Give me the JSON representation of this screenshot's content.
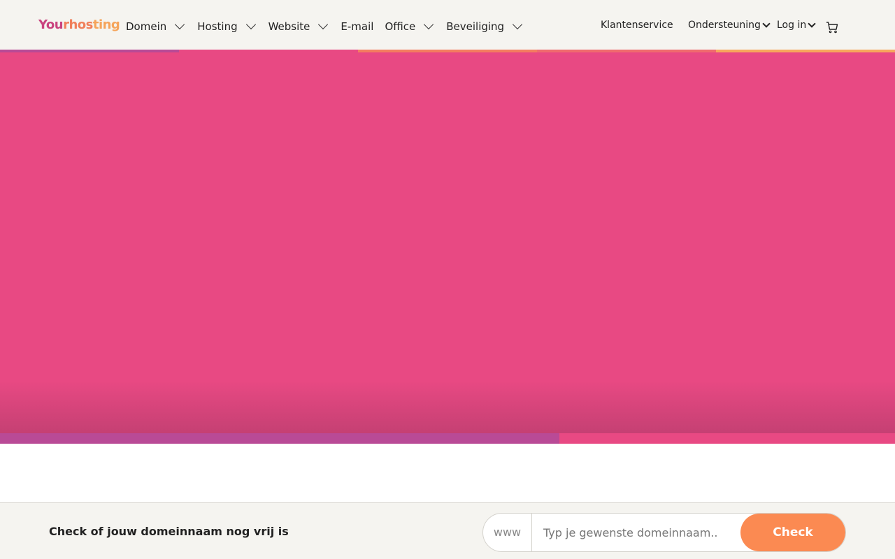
{
  "header": {
    "logo": {
      "part1": "You",
      "part2": "rhos",
      "part3": "ting"
    },
    "nav": [
      {
        "label": "Domein",
        "has_dropdown": true
      },
      {
        "label": "Hosting",
        "has_dropdown": true
      },
      {
        "label": "Website",
        "has_dropdown": true
      },
      {
        "label": "E-mail",
        "has_dropdown": false
      },
      {
        "label": "Office",
        "has_dropdown": true
      },
      {
        "label": "Beveiliging",
        "has_dropdown": true
      }
    ],
    "right": {
      "customer_service": "Klantenservice",
      "support": "Ondersteuning",
      "login": "Log in",
      "cart_icon": "cart-icon"
    }
  },
  "colors": {
    "hero": "#e84983",
    "stripe_purple": "#b94a96",
    "stripe_pink": "#e84983",
    "stripe_coral": "#f47d60",
    "stripe_orange": "#f8a75c",
    "check_button": "#fb8a52",
    "bar_bg": "#f5f4f0"
  },
  "domain_check": {
    "title": "Check of jouw domeinnaam nog vrij is",
    "prefix": "www",
    "placeholder": "Typ je gewenste domeinnaam..",
    "button": "Check"
  }
}
